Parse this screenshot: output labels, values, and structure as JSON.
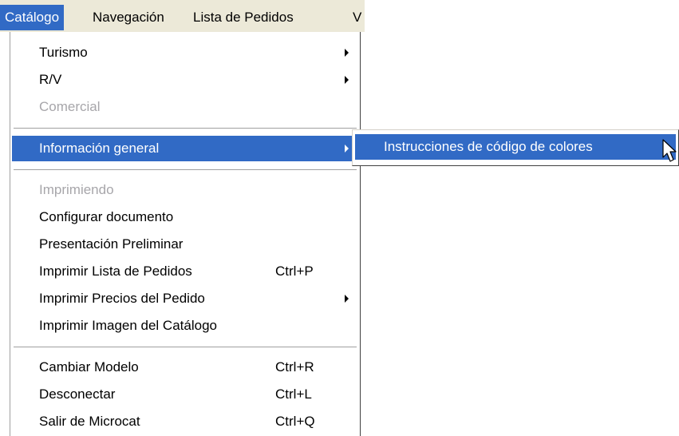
{
  "menubar": {
    "items": [
      {
        "label": "Catálogo"
      },
      {
        "label": "Navegación"
      },
      {
        "label": "Lista de Pedidos"
      },
      {
        "label": "V"
      }
    ]
  },
  "menu": {
    "items": [
      {
        "label": "Turismo",
        "submenu": true
      },
      {
        "label": "R/V",
        "submenu": true
      },
      {
        "label": "Comercial",
        "disabled": true
      },
      {
        "label": "Información general",
        "submenu": true,
        "highlighted": true
      },
      {
        "label": "Imprimiendo",
        "disabled": true
      },
      {
        "label": "Configurar documento"
      },
      {
        "label": "Presentación Preliminar"
      },
      {
        "label": "Imprimir Lista de Pedidos",
        "shortcut": "Ctrl+P"
      },
      {
        "label": "Imprimir Precios del Pedido",
        "submenu": true
      },
      {
        "label": "Imprimir Imagen del Catálogo"
      },
      {
        "label": "Cambiar Modelo",
        "shortcut": "Ctrl+R"
      },
      {
        "label": "Desconectar",
        "shortcut": "Ctrl+L"
      },
      {
        "label": "Salir de Microcat",
        "shortcut": "Ctrl+Q"
      }
    ]
  },
  "submenu": {
    "items": [
      {
        "label": "Instrucciones de código de colores",
        "highlighted": true
      }
    ]
  },
  "colors": {
    "highlight": "#316ac5",
    "menubar_bg": "#ece9d8",
    "disabled_text": "#a7a6aa"
  }
}
